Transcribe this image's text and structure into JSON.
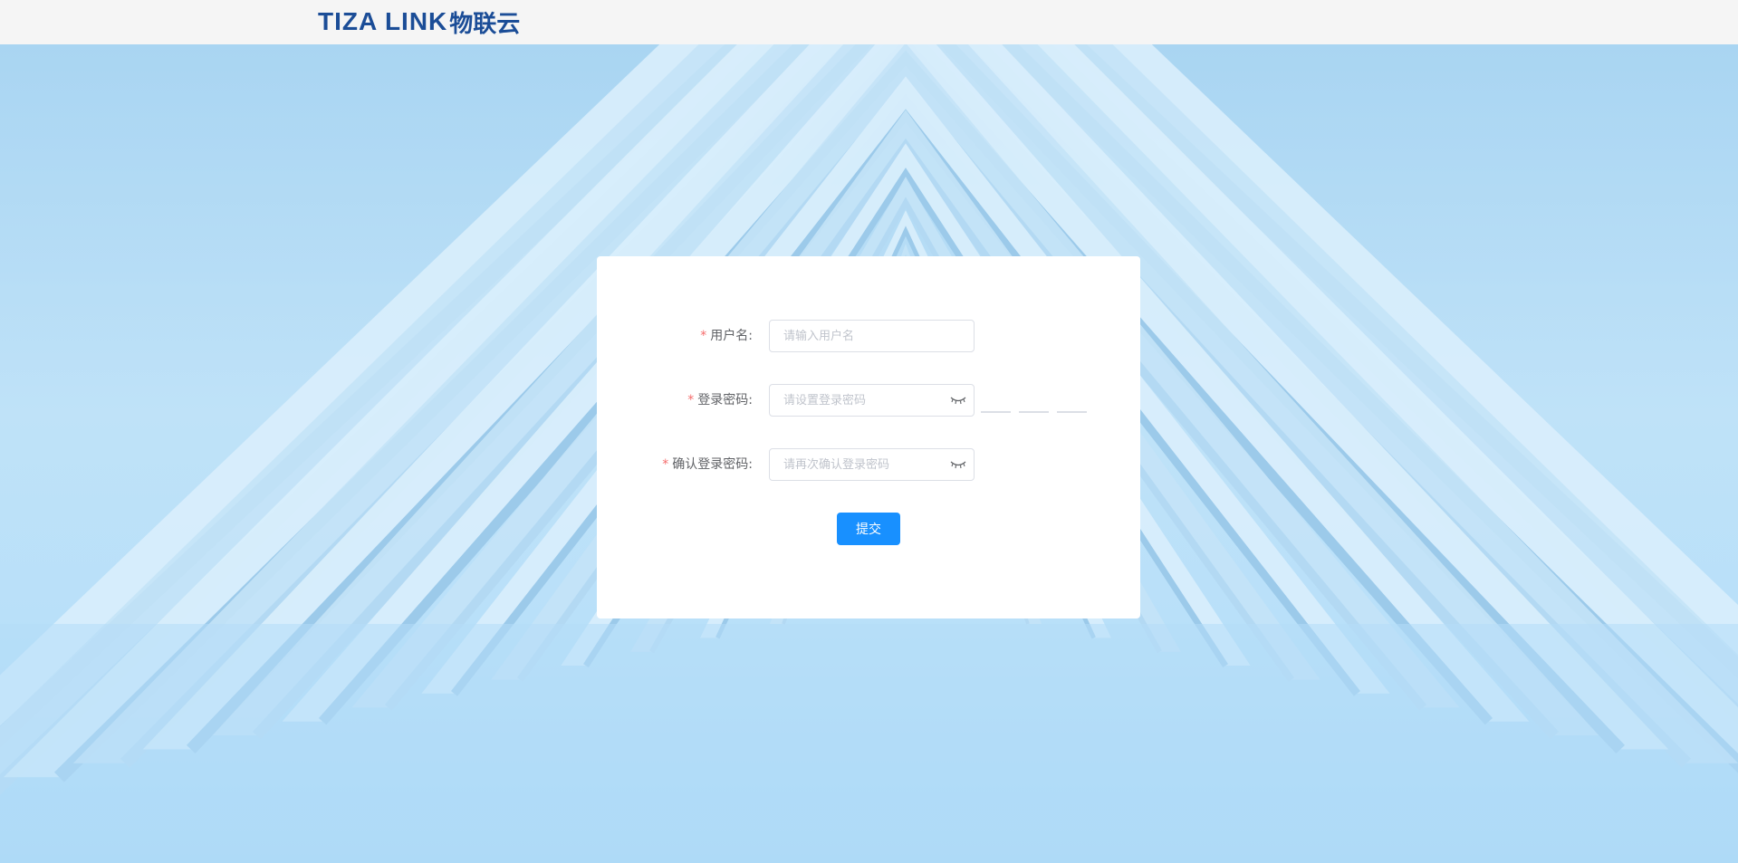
{
  "header": {
    "logo_text": "TIZA LINK",
    "logo_cn": "物联云"
  },
  "form": {
    "required_mark": "*",
    "username": {
      "label": "用户名:",
      "placeholder": "请输入用户名",
      "value": ""
    },
    "password": {
      "label": "登录密码:",
      "placeholder": "请设置登录密码",
      "value": "",
      "toggle_icon": "eye-closed-icon",
      "strength_level": 0
    },
    "confirm_password": {
      "label": "确认登录密码:",
      "placeholder": "请再次确认登录密码",
      "value": "",
      "toggle_icon": "eye-closed-icon"
    },
    "submit_label": "提交"
  },
  "colors": {
    "brand": "#1b4d97",
    "primary": "#1890ff",
    "required": "#f56c6c",
    "background": "#b9e0f9"
  }
}
